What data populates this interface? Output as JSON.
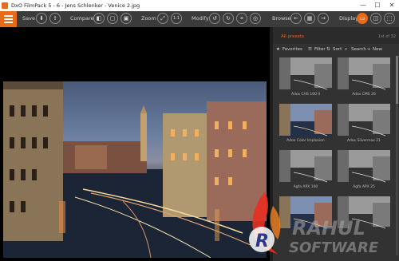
{
  "window": {
    "title": "DxO FilmPack 5 - 6 - Jens Schlenker - Venice 2.jpg",
    "minimize": "—",
    "maximize": "☐",
    "close": "✕"
  },
  "toolbar": {
    "save_label": "Save",
    "compare_label": "Compare",
    "zoom_label": "Zoom",
    "zoom_fit": "1:1",
    "modify_label": "Modify",
    "browse_label": "Browse",
    "display_label": "Display"
  },
  "panel": {
    "title": "All presets",
    "count": "1st of 32",
    "filters": {
      "favorites": "Favorites",
      "filter": "Filter",
      "sort": "Sort",
      "search": "Search",
      "new": "New"
    },
    "presets": [
      {
        "label": "Adox CHS 100 II",
        "style": "bw"
      },
      {
        "label": "Adox CMS 20",
        "style": "bw"
      },
      {
        "label": "Adox Color Implosion",
        "style": "color"
      },
      {
        "label": "Adox Silvermax 21",
        "style": "bw"
      },
      {
        "label": "Agfa APX 100",
        "style": "bw"
      },
      {
        "label": "Agfa APX 25",
        "style": "bw"
      },
      {
        "label": "",
        "style": "color"
      },
      {
        "label": "",
        "style": "bw"
      }
    ]
  },
  "watermark": {
    "line1": "RAHUL",
    "line2": "SOFTWARE",
    "mark": "R"
  },
  "colors": {
    "accent": "#e86a1a",
    "panel": "#323232",
    "toolbar": "#3b3b3b"
  }
}
